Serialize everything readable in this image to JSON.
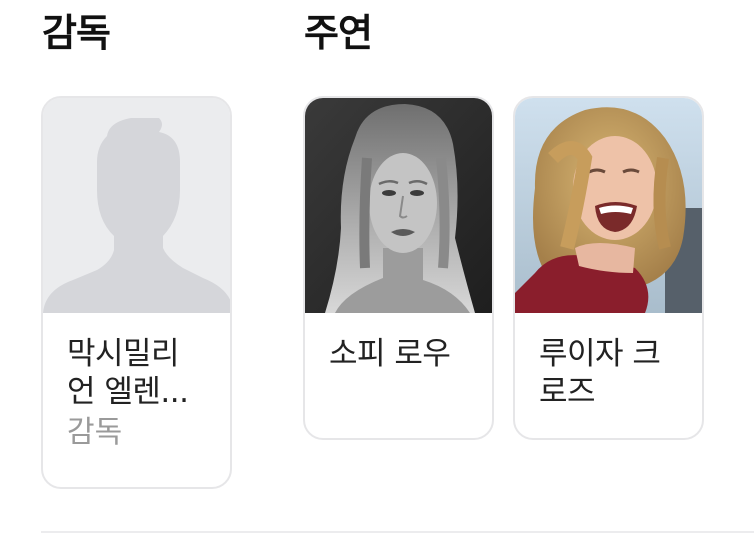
{
  "sections": {
    "director_title": "감독",
    "cast_title": "주연"
  },
  "director": {
    "name": "막시밀리\n언 엘렌...",
    "role": "감독",
    "photo": "person-placeholder-icon"
  },
  "cast": [
    {
      "name": "소피 로우",
      "photo": "grayscale-portrait"
    },
    {
      "name": "루이자 크\n로즈",
      "photo": "smiling-portrait"
    }
  ],
  "colors": {
    "card_border": "#e6e6e8",
    "placeholder_bg": "#ebecee",
    "placeholder_silhouette": "#d5d6da",
    "role_text": "#9a9a9a"
  }
}
